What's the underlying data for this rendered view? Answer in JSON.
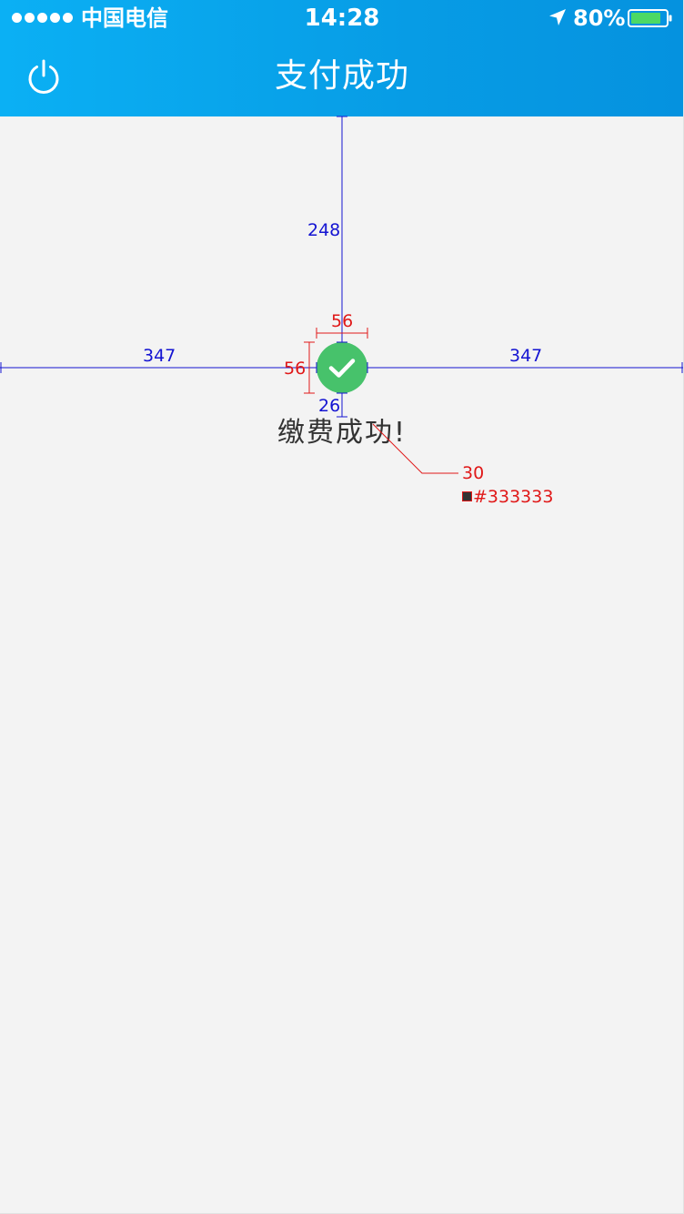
{
  "status_bar": {
    "carrier": "中国电信",
    "time": "14:28",
    "battery": "80%",
    "battery_level": 0.8,
    "icons": [
      "signal-dots-icon",
      "location-arrow-icon",
      "battery-icon"
    ]
  },
  "nav": {
    "title": "支付成功",
    "left_icon": "power-icon"
  },
  "content": {
    "icon": "checkmark-circle-icon",
    "message": "缴费成功!"
  },
  "annotations": {
    "top_gap": "248",
    "icon_width": "56",
    "icon_height": "56",
    "left_gap": "347",
    "right_gap": "347",
    "icon_text_gap": "26",
    "font_size": "30",
    "text_color": "#333333"
  },
  "colors": {
    "header_start": "#0bb0f4",
    "header_end": "#0592df",
    "background": "#f3f3f3",
    "success_green": "#47c26b",
    "text": "#333333",
    "battery_fill": "#4cd964",
    "annotation_blue": "#1414d2",
    "annotation_red": "#e01818"
  }
}
